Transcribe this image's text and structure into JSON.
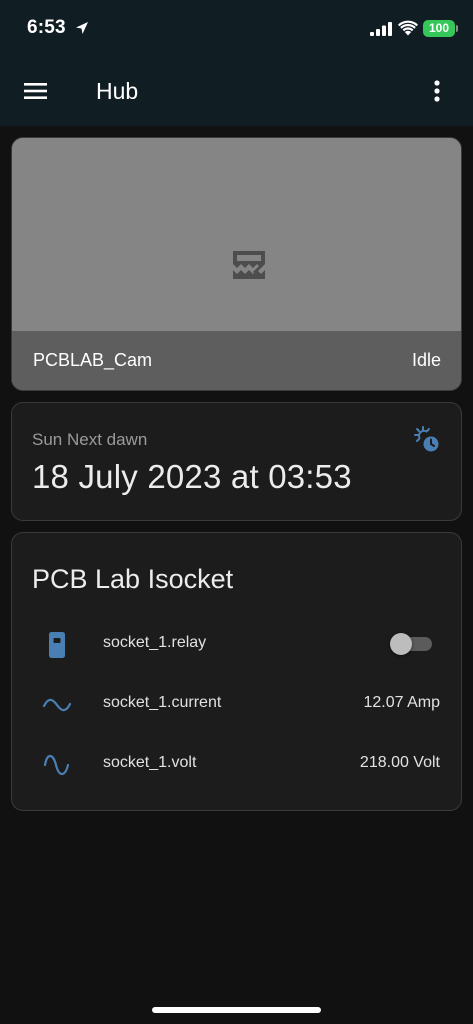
{
  "status_bar": {
    "time": "6:53",
    "battery": "100"
  },
  "app_bar": {
    "title": "Hub"
  },
  "camera_card": {
    "name": "PCBLAB_Cam",
    "state": "Idle"
  },
  "sun_card": {
    "label": "Sun Next dawn",
    "value": "18 July 2023 at 03:53"
  },
  "entities_card": {
    "title": "PCB Lab Isocket",
    "rows": [
      {
        "name": "socket_1.relay",
        "value": "",
        "icon": "power-socket-icon",
        "toggle_on": false
      },
      {
        "name": "socket_1.current",
        "value": "12.07 Amp",
        "icon": "current-ac-icon"
      },
      {
        "name": "socket_1.volt",
        "value": "218.00 Volt",
        "icon": "sine-wave-icon"
      }
    ]
  },
  "colors": {
    "topbar_bg": "#101e24",
    "page_bg": "#111111",
    "card_bg": "#1c1c1c",
    "icon_blue": "#4a7fb3",
    "battery_green": "#35c759"
  }
}
